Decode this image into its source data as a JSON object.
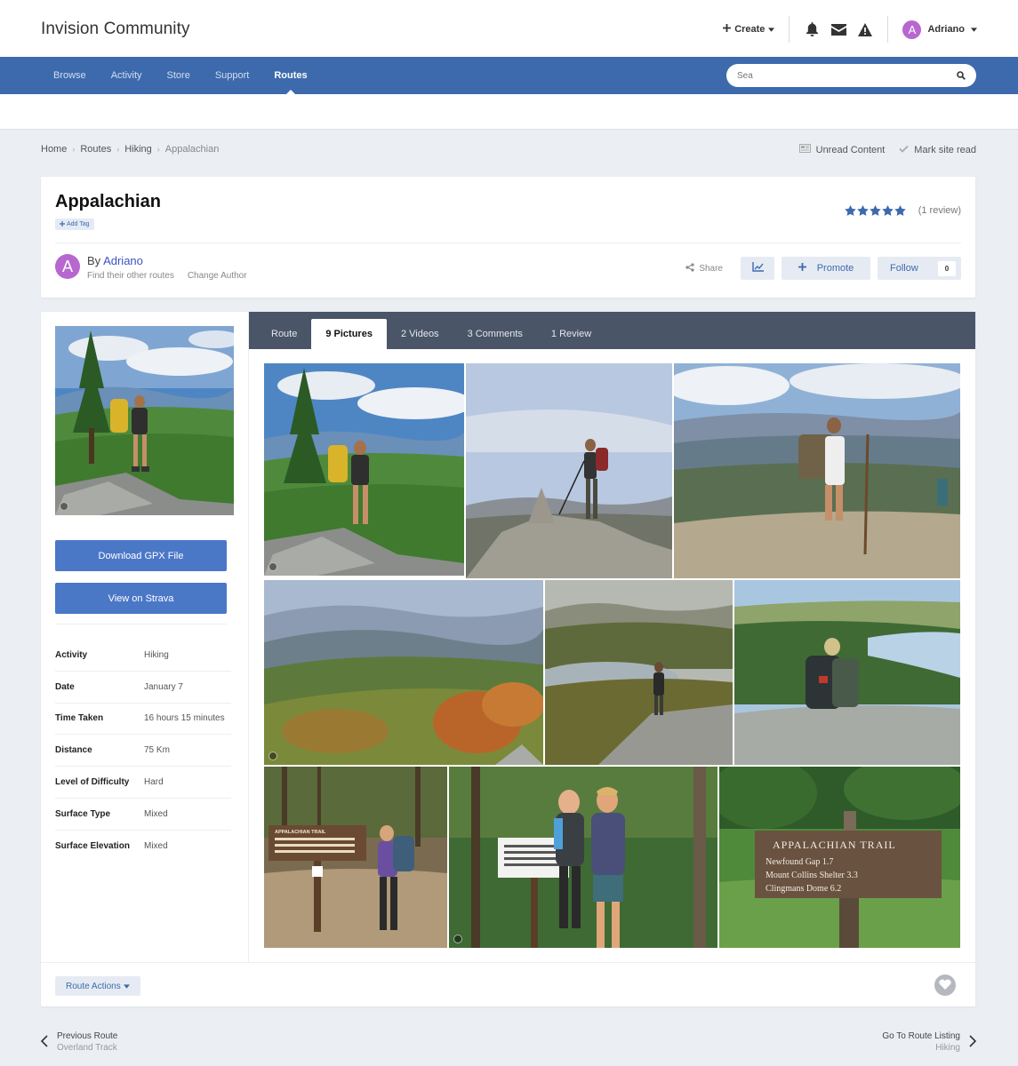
{
  "header": {
    "site_title": "Invision Community",
    "create_label": "Create",
    "user_initial": "A",
    "user_name": "Adriano"
  },
  "nav": {
    "items": [
      {
        "label": "Browse"
      },
      {
        "label": "Activity"
      },
      {
        "label": "Store"
      },
      {
        "label": "Support"
      },
      {
        "label": "Routes"
      }
    ],
    "active": "Routes",
    "search_placeholder": "Sea"
  },
  "breadcrumb": {
    "items": [
      "Home",
      "Routes",
      "Hiking",
      "Appalachian"
    ],
    "unread_label": "Unread Content",
    "mark_read_label": "Mark site read"
  },
  "route": {
    "title": "Appalachian",
    "add_tag_label": "Add Tag",
    "rating": 5,
    "review_count_label": "(1 review)",
    "author_initial": "A",
    "by_label": "By",
    "author_name": "Adriano",
    "find_other_label": "Find their other routes",
    "change_author_label": "Change Author",
    "share_label": "Share",
    "promote_label": "Promote",
    "follow_label": "Follow",
    "follow_count": "0"
  },
  "sidebar": {
    "download_label": "Download GPX File",
    "strava_label": "View on Strava",
    "details": [
      {
        "label": "Activity",
        "value": "Hiking"
      },
      {
        "label": "Date",
        "value": "January 7"
      },
      {
        "label": "Time Taken",
        "value": "16 hours 15 minutes"
      },
      {
        "label": "Distance",
        "value": "75 Km"
      },
      {
        "label": "Level of Difficulty",
        "value": "Hard"
      },
      {
        "label": "Surface Type",
        "value": "Mixed"
      },
      {
        "label": "Surface Elevation",
        "value": "Mixed"
      }
    ]
  },
  "tabs": [
    {
      "label": "Route"
    },
    {
      "label": "9 Pictures"
    },
    {
      "label": "2 Videos"
    },
    {
      "label": "3 Comments"
    },
    {
      "label": "1 Review"
    }
  ],
  "active_tab": "9 Pictures",
  "gallery": {
    "photos": [
      "hiker-yellow-pack-overlook",
      "hiker-trekking-poles-summit",
      "hiker-walking-stick-ridge",
      "autumn-mountains",
      "hiker-lake-view",
      "hiker-sitting-lake",
      "hiker-trail-sign",
      "couple-at-trail-sign",
      "appalachian-trail-sign"
    ]
  },
  "sign_text": {
    "photo7_title": "APPALACHIAN TRAIL",
    "photo9_title": "APPALACHIAN TRAIL",
    "photo9_lines": [
      "Newfound Gap 1.7",
      "Mount Collins Shelter 3.3",
      "Clingmans Dome 6.2"
    ]
  },
  "footer": {
    "route_actions_label": "Route Actions"
  },
  "pager": {
    "prev_label": "Previous Route",
    "prev_title": "Overland Track",
    "next_label": "Go To Route Listing",
    "next_title": "Hiking"
  },
  "colors": {
    "nav_bg": "#3d6aad",
    "tab_bar_bg": "#4a5568",
    "primary_button": "#4b77c7",
    "avatar": "#b767cf",
    "star": "#3d6aad"
  }
}
